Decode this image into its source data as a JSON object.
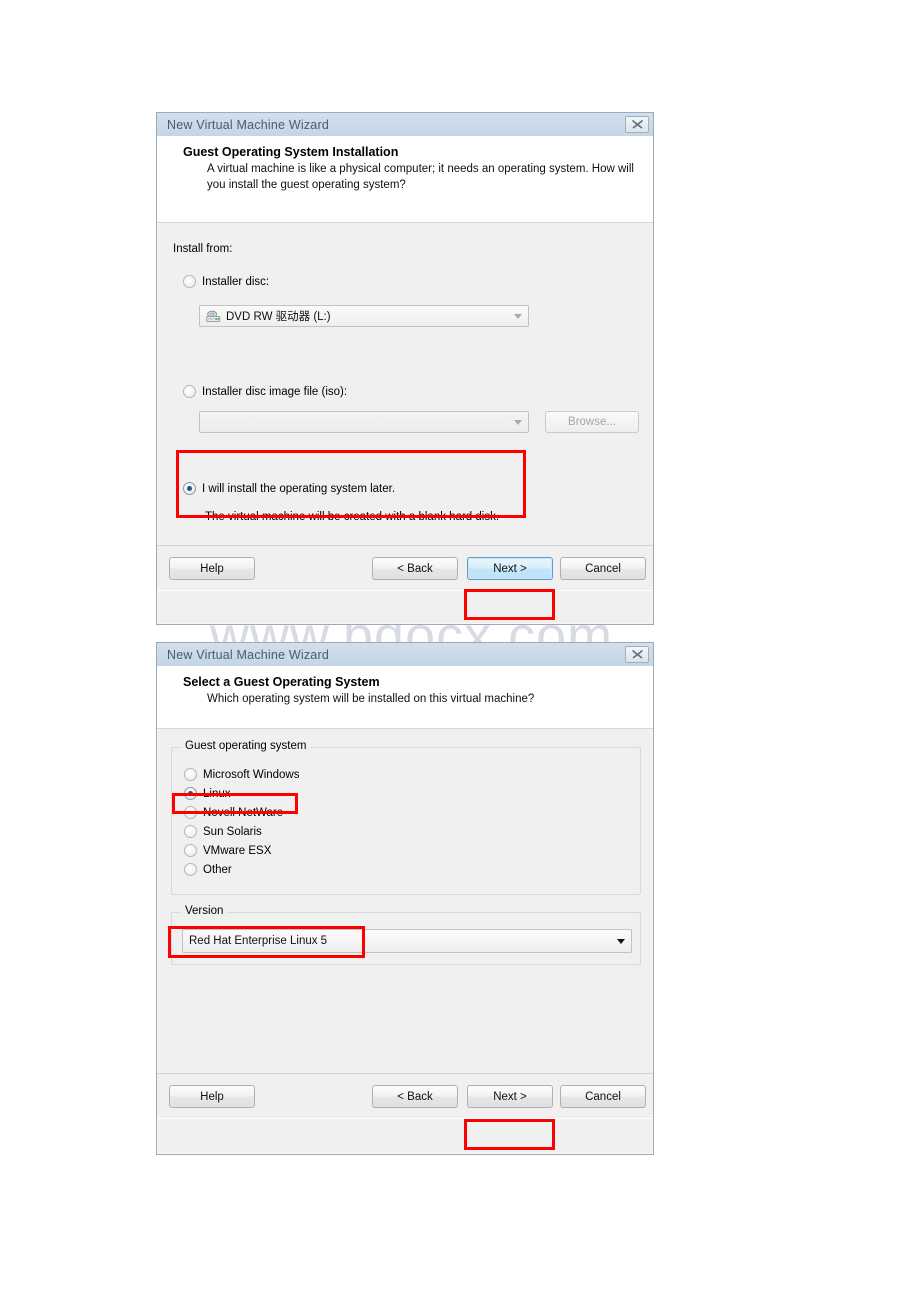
{
  "watermark": {
    "text": "www.bdocx.com"
  },
  "dialog1": {
    "title": "New Virtual Machine Wizard",
    "close_icon": "close-icon",
    "header": {
      "heading": "Guest Operating System Installation",
      "description": "A virtual machine is like a physical computer; it needs an operating system. How will you install the guest operating system?"
    },
    "install_from_label": "Install from:",
    "options": [
      {
        "label": "Installer disc:",
        "selected": false
      },
      {
        "label": "Installer disc image file (iso):",
        "selected": false
      },
      {
        "label": "I will install the operating system later.",
        "selected": true
      }
    ],
    "disc_combo": {
      "value": "DVD RW 驱动器 (L:)",
      "icon": "optical-drive-icon"
    },
    "iso_combo": {
      "value": "",
      "placeholder": ""
    },
    "browse_button": "Browse...",
    "later_note": "The virtual machine will be created with a blank hard disk.",
    "footer": {
      "help": "Help",
      "back": "< Back",
      "next": "Next >",
      "cancel": "Cancel"
    }
  },
  "dialog2": {
    "title": "New Virtual Machine Wizard",
    "close_icon": "close-icon",
    "header": {
      "heading": "Select a Guest Operating System",
      "description": "Which operating system will be installed on this virtual machine?"
    },
    "guest_os_group_label": "Guest operating system",
    "guest_os_options": [
      {
        "label": "Microsoft Windows",
        "selected": false
      },
      {
        "label": "Linux",
        "selected": true
      },
      {
        "label": "Novell NetWare",
        "selected": false
      },
      {
        "label": "Sun Solaris",
        "selected": false
      },
      {
        "label": "VMware ESX",
        "selected": false
      },
      {
        "label": "Other",
        "selected": false
      }
    ],
    "version_group_label": "Version",
    "version_value": "Red Hat Enterprise Linux 5",
    "footer": {
      "help": "Help",
      "back": "< Back",
      "next": "Next >",
      "cancel": "Cancel"
    }
  },
  "annotations": {
    "accent_color": "#ff0000",
    "focus_color": "#5f9ccc"
  }
}
